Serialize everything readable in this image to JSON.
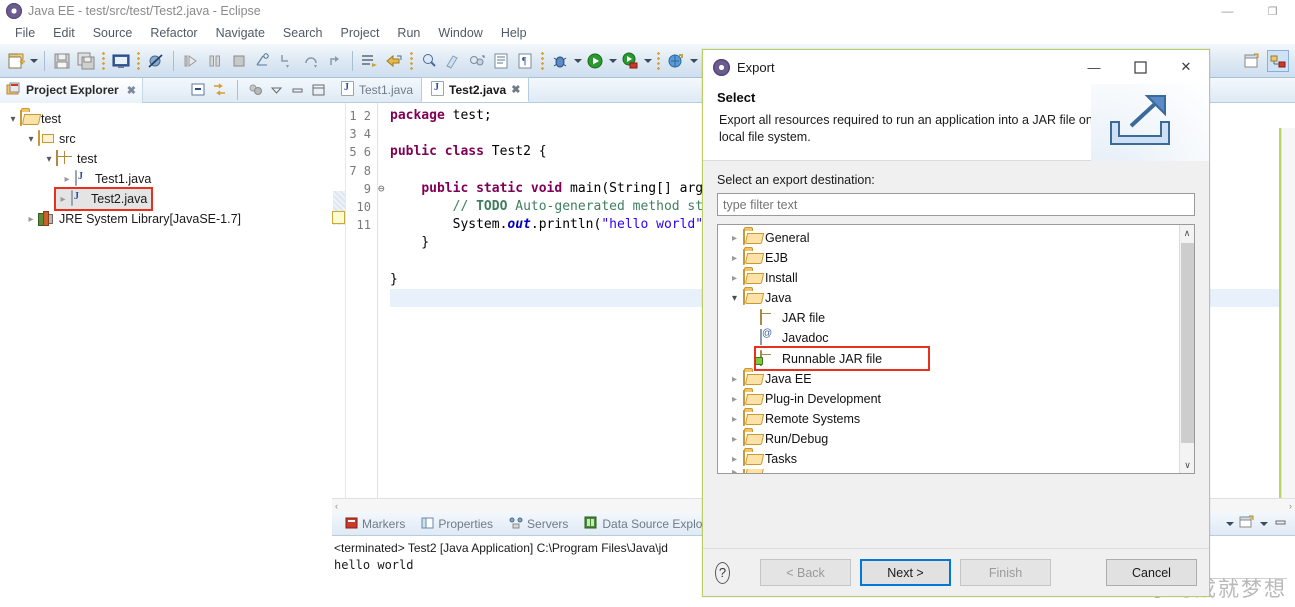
{
  "window": {
    "title": "Java EE - test/src/test/Test2.java - Eclipse",
    "app_icon": "eclipse-icon",
    "controls": {
      "minimize": "—",
      "restore": "❐",
      "close": "✕"
    }
  },
  "menubar": {
    "items": [
      {
        "label": "File"
      },
      {
        "label": "Edit"
      },
      {
        "label": "Source"
      },
      {
        "label": "Refactor"
      },
      {
        "label": "Navigate"
      },
      {
        "label": "Search"
      },
      {
        "label": "Project"
      },
      {
        "label": "Run"
      },
      {
        "label": "Window"
      },
      {
        "label": "Help"
      }
    ]
  },
  "toolbar": {
    "buttons": [
      {
        "name": "new-wizard-icon"
      },
      {
        "name": "new-wizard-dropdown-icon"
      },
      {
        "name": "save-icon"
      },
      {
        "name": "save-all-icon"
      },
      {
        "name": "open-console-icon"
      },
      {
        "name": "skip-breakpoints-icon"
      },
      {
        "name": "resume-icon"
      },
      {
        "name": "suspend-icon"
      },
      {
        "name": "terminate-icon"
      },
      {
        "name": "disconnect-icon"
      },
      {
        "name": "step-into-icon"
      },
      {
        "name": "step-over-icon"
      },
      {
        "name": "step-return-icon"
      },
      {
        "name": "open-task-icon"
      },
      {
        "name": "open-type-icon"
      },
      {
        "name": "search-icon"
      },
      {
        "name": "brush-icon"
      },
      {
        "name": "link-icon"
      },
      {
        "name": "toggle-block-icon"
      },
      {
        "name": "mark-occurrences-icon"
      },
      {
        "name": "debug-icon"
      },
      {
        "name": "debug-dropdown-icon"
      },
      {
        "name": "run-icon"
      },
      {
        "name": "run-dropdown-icon"
      },
      {
        "name": "run-server-icon"
      },
      {
        "name": "run-server-dropdown-icon"
      },
      {
        "name": "external-tools-icon"
      },
      {
        "name": "external-tools-dropdown-icon"
      },
      {
        "name": "subversion-icon"
      },
      {
        "name": "subversion-dropdown-icon"
      }
    ],
    "perspective": [
      {
        "name": "open-perspective-icon"
      },
      {
        "name": "perspective-java-ee-icon"
      }
    ]
  },
  "project_explorer": {
    "tab_label": "Project Explorer",
    "tab_close": "✖",
    "tools": [
      {
        "name": "collapse-all-icon"
      },
      {
        "name": "link-with-editor-icon"
      },
      {
        "name": "focus-on-active-task-icon"
      },
      {
        "name": "view-menu-icon"
      },
      {
        "name": "minimize-icon"
      },
      {
        "name": "maximize-icon"
      }
    ],
    "tree": [
      {
        "label": "test",
        "icon": "project-folder-icon",
        "indent": 0,
        "arrow": "open",
        "selected": false
      },
      {
        "label": "src",
        "icon": "source-folder-icon",
        "indent": 1,
        "arrow": "open",
        "selected": false
      },
      {
        "label": "test",
        "icon": "package-icon",
        "indent": 2,
        "arrow": "open",
        "selected": false
      },
      {
        "label": "Test1.java",
        "icon": "java-file-icon",
        "indent": 3,
        "arrow": "closed",
        "selected": false
      },
      {
        "label": "Test2.java",
        "icon": "java-file-icon",
        "indent": 3,
        "arrow": "closed",
        "selected": true
      },
      {
        "label": "JRE System Library",
        "suffix": " [JavaSE-1.7]",
        "icon": "jre-library-icon",
        "indent": 1,
        "arrow": "closed",
        "selected": false
      }
    ]
  },
  "editor": {
    "tabs": [
      {
        "label": "Test1.java",
        "active": false,
        "icon": "java-file-icon"
      },
      {
        "label": "Test2.java",
        "active": true,
        "icon": "java-file-icon",
        "close": "✖"
      }
    ],
    "line_numbers": [
      "1",
      "2",
      "3",
      "4",
      "5",
      "6",
      "7",
      "8",
      "9",
      "10",
      "11"
    ],
    "fold_markers": {
      "5": "⊖"
    },
    "cursor_line": 11,
    "code_lines": [
      "package test;",
      "",
      "public class Test2 {",
      "",
      "    public static void main(String[] args) {",
      "        // TODO Auto-generated method stub",
      "        System.out.println(\"hello world\");",
      "    }",
      "",
      "}",
      ""
    ],
    "scroll_left": "‹",
    "scroll_right": "›"
  },
  "console": {
    "tabs": [
      {
        "label": "Markers",
        "icon": "markers-icon"
      },
      {
        "label": "Properties",
        "icon": "properties-icon"
      },
      {
        "label": "Servers",
        "icon": "servers-icon"
      },
      {
        "label": "Data Source Explo",
        "icon": "data-source-explorer-icon"
      }
    ],
    "tools": [
      {
        "name": "display-selected-console-dropdown-icon"
      },
      {
        "name": "open-console-icon"
      },
      {
        "name": "console-menu-icon"
      },
      {
        "name": "minimize-icon"
      }
    ],
    "terminated_line": "<terminated> Test2 [Java Application] C:\\Program Files\\Java\\jd",
    "output_line": "hello world"
  },
  "dialog": {
    "title": "Export",
    "title_icon": "eclipse-icon",
    "controls": {
      "minimize": "—",
      "maximize": "❐",
      "close": "✕"
    },
    "heading": "Select",
    "description": "Export all resources required to run an application into a JAR file on the local file system.",
    "banner_icon": "export-arrow-icon",
    "destination_label": "Select an export destination:",
    "filter_placeholder": "type filter text",
    "filter_value": "",
    "tree": [
      {
        "label": "General",
        "icon": "folder-icon",
        "arrow": "closed",
        "level": 0,
        "selected": false
      },
      {
        "label": "EJB",
        "icon": "folder-icon",
        "arrow": "closed",
        "level": 0,
        "selected": false
      },
      {
        "label": "Install",
        "icon": "folder-icon",
        "arrow": "closed",
        "level": 0,
        "selected": false
      },
      {
        "label": "Java",
        "icon": "folder-icon",
        "arrow": "open",
        "level": 0,
        "selected": false
      },
      {
        "label": "JAR file",
        "icon": "jar-file-icon",
        "arrow": "none",
        "level": 1,
        "selected": false
      },
      {
        "label": "Javadoc",
        "icon": "javadoc-icon",
        "arrow": "none",
        "level": 1,
        "selected": false
      },
      {
        "label": "Runnable JAR file",
        "icon": "runnable-jar-icon",
        "arrow": "none",
        "level": 1,
        "selected": true
      },
      {
        "label": "Java EE",
        "icon": "folder-icon",
        "arrow": "closed",
        "level": 0,
        "selected": false
      },
      {
        "label": "Plug-in Development",
        "icon": "folder-icon",
        "arrow": "closed",
        "level": 0,
        "selected": false
      },
      {
        "label": "Remote Systems",
        "icon": "folder-icon",
        "arrow": "closed",
        "level": 0,
        "selected": false
      },
      {
        "label": "Run/Debug",
        "icon": "folder-icon",
        "arrow": "closed",
        "level": 0,
        "selected": false
      },
      {
        "label": "Tasks",
        "icon": "folder-icon",
        "arrow": "closed",
        "level": 0,
        "selected": false
      }
    ],
    "scroll": {
      "up": "∧",
      "down": "∨"
    },
    "help_label": "?",
    "buttons": {
      "back": "< Back",
      "next": "Next >",
      "finish": "Finish",
      "cancel": "Cancel"
    }
  },
  "watermark": {
    "text": "学习成就梦想"
  },
  "colors": {
    "selection_red": "#e8301c",
    "tree_selection_blue": "#cde8ff",
    "focus_blue": "#0078d7",
    "keyword": "#7f0055",
    "comment": "#3f7f5f",
    "string": "#2a00ff",
    "field": "#0000c0",
    "dialog_border": "#b9cf63"
  }
}
